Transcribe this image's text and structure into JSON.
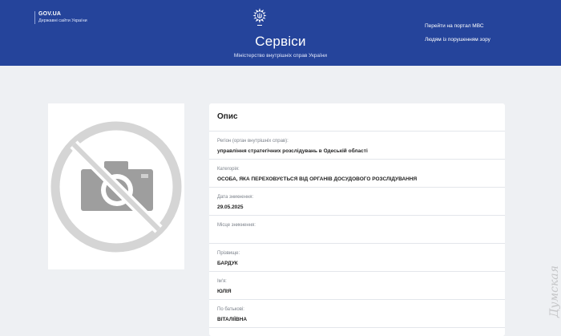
{
  "header": {
    "gov_title": "GOV.UA",
    "gov_subtitle": "Державні сайти України",
    "site_title": "Сервіси",
    "ministry": "Міністерство внутрішніх справ України",
    "links": [
      "Перейти на портал МВС",
      "Людям із порушенням зору"
    ]
  },
  "photo": {
    "icon": "no-photo-icon"
  },
  "card": {
    "title": "Опис",
    "fields": [
      {
        "label": "Регіон (орган внутрішніх справ):",
        "value": "управління стратегічних розслідувань в Одеській області"
      },
      {
        "label": "Категорія:",
        "value": "ОСОБА, ЯКА ПЕРЕХОВУЄТЬСЯ ВІД ОРГАНІВ ДОСУДОВОГО РОЗСЛІДУВАННЯ"
      },
      {
        "label": "Дата зникнення:",
        "value": "29.05.2025"
      },
      {
        "label": "Місце зникнення:",
        "value": ""
      },
      {
        "label": "Прізвище:",
        "value": "БАРДУК"
      },
      {
        "label": "Ім'я:",
        "value": "ЮЛІЯ"
      },
      {
        "label": "По батькові:",
        "value": "ВІТАЛІЇВНА"
      }
    ]
  },
  "watermark": "Думская",
  "colors": {
    "header": "#25449b",
    "background": "#eef0f3"
  }
}
